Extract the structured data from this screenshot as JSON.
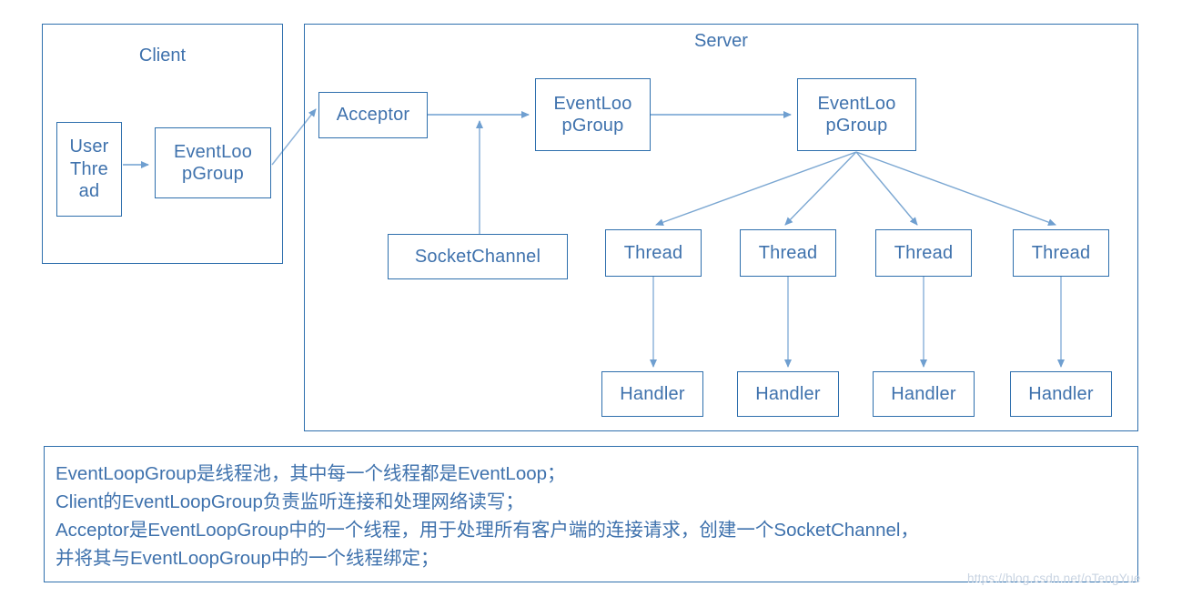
{
  "diagram": {
    "title_client": "Client",
    "title_server": "Server",
    "colors": {
      "stroke": "#2e6fad",
      "text": "#3f72ad",
      "arrow": "#6f9fd0",
      "watermark": "#c9d4e2",
      "background": "#ffffff"
    },
    "client": {
      "label": "Client",
      "nodes": [
        {
          "id": "user-thread",
          "label": "User Thre ad",
          "lines": [
            "User",
            "Thre",
            "ad"
          ]
        },
        {
          "id": "client-eventloopgroup",
          "label": "EventLoopGroup",
          "lines": [
            "EventLoo",
            "pGroup"
          ]
        }
      ]
    },
    "server": {
      "label": "Server",
      "nodes": [
        {
          "id": "acceptor",
          "label": "Acceptor",
          "lines": [
            "Acceptor"
          ]
        },
        {
          "id": "socketchannel",
          "label": "SocketChannel",
          "lines": [
            "SocketChannel"
          ]
        },
        {
          "id": "eventloopgroup-boss",
          "label": "EventLoopGroup",
          "lines": [
            "EventLoo",
            "pGroup"
          ]
        },
        {
          "id": "eventloopgroup-worker",
          "label": "EventLoopGroup",
          "lines": [
            "EventLoo",
            "pGroup"
          ]
        }
      ],
      "threads": [
        {
          "label": "Thread"
        },
        {
          "label": "Thread"
        },
        {
          "label": "Thread"
        },
        {
          "label": "Thread"
        }
      ],
      "handlers": [
        {
          "label": "Handler"
        },
        {
          "label": "Handler"
        },
        {
          "label": "Handler"
        },
        {
          "label": "Handler"
        }
      ]
    },
    "edges": [
      {
        "from": "user-thread",
        "to": "client-eventloopgroup"
      },
      {
        "from": "client-eventloopgroup",
        "to": "acceptor"
      },
      {
        "from": "acceptor",
        "to": "eventloopgroup-boss"
      },
      {
        "from": "socketchannel",
        "to": "acceptor-eventloopgroup-link"
      },
      {
        "from": "eventloopgroup-boss",
        "to": "eventloopgroup-worker"
      },
      {
        "from": "eventloopgroup-worker",
        "to": "thread-0"
      },
      {
        "from": "eventloopgroup-worker",
        "to": "thread-1"
      },
      {
        "from": "eventloopgroup-worker",
        "to": "thread-2"
      },
      {
        "from": "eventloopgroup-worker",
        "to": "thread-3"
      },
      {
        "from": "thread-0",
        "to": "handler-0"
      },
      {
        "from": "thread-1",
        "to": "handler-1"
      },
      {
        "from": "thread-2",
        "to": "handler-2"
      },
      {
        "from": "thread-3",
        "to": "handler-3"
      }
    ]
  },
  "notes": {
    "lines": [
      "EventLoopGroup是线程池，其中每一个线程都是EventLoop；",
      "Client的EventLoopGroup负责监听连接和处理网络读写；",
      "Acceptor是EventLoopGroup中的一个线程，用于处理所有客户端的连接请求，创建一个SocketChannel，",
      "并将其与EventLoopGroup中的一个线程绑定；"
    ]
  },
  "watermark": {
    "text": "https://blog.csdn.net/oTengYue"
  }
}
